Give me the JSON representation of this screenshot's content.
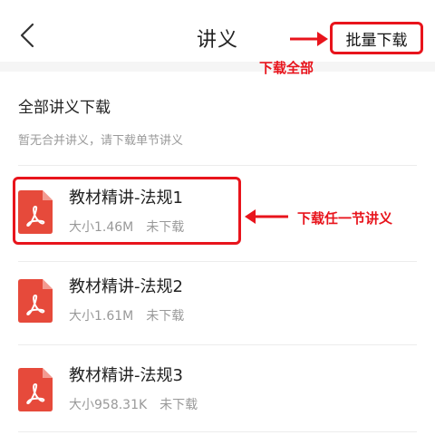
{
  "header": {
    "back_icon": "chevron-left-icon",
    "title": "讲义",
    "batch_download_label": "批量下载"
  },
  "annotations": {
    "download_all": "下载全部",
    "download_one": "下载任一节讲义"
  },
  "all_section": {
    "title": "全部讲义下载",
    "subtitle": "暂无合并讲义，请下载单节讲义"
  },
  "files": [
    {
      "name": "教材精讲-法规1",
      "size": "大小1.46M",
      "status": "未下载",
      "icon": "pdf-file-icon"
    },
    {
      "name": "教材精讲-法规2",
      "size": "大小1.61M",
      "status": "未下载",
      "icon": "pdf-file-icon"
    },
    {
      "name": "教材精讲-法规3",
      "size": "大小958.31K",
      "status": "未下载",
      "icon": "pdf-file-icon"
    }
  ],
  "colors": {
    "accent_red": "#e8141c",
    "pdf_icon": "#e64a3b"
  }
}
